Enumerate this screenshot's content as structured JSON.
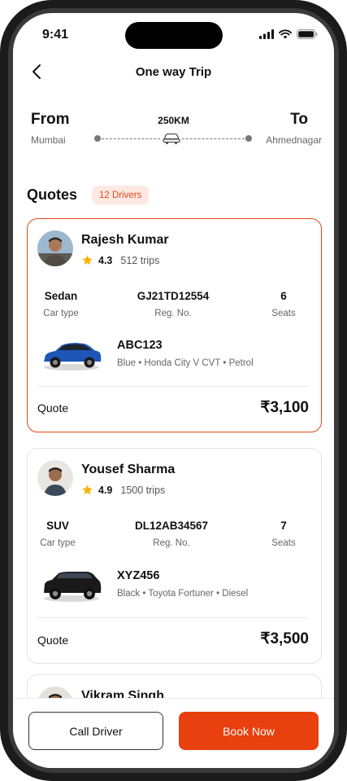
{
  "status_bar": {
    "time": "9:41"
  },
  "header": {
    "title": "One way Trip",
    "back_icon": "chevron-left-icon"
  },
  "route": {
    "from_label": "From",
    "from_city": "Mumbai",
    "to_label": "To",
    "to_city": "Ahmednagar",
    "distance": "250KM"
  },
  "quotes_section": {
    "title": "Quotes",
    "drivers_badge": "12 Drivers"
  },
  "quotes": [
    {
      "driver_name": "Rajesh Kumar",
      "rating": "4.3",
      "trips": "512 trips",
      "car_type": "Sedan",
      "car_type_label": "Car type",
      "reg_no": "GJ21TD12554",
      "reg_no_label": "Reg. No.",
      "seats": "6",
      "seats_label": "Seats",
      "plate": "ABC123",
      "car_desc": "Blue • Honda City V CVT • Petrol",
      "car_color": "#1e56b8",
      "quote_label": "Quote",
      "quote_value": "₹3,100",
      "selected": true
    },
    {
      "driver_name": "Yousef Sharma",
      "rating": "4.9",
      "trips": "1500 trips",
      "car_type": "SUV",
      "car_type_label": "Car type",
      "reg_no": "DL12AB34567",
      "reg_no_label": "Reg. No.",
      "seats": "7",
      "seats_label": "Seats",
      "plate": "XYZ456",
      "car_desc": "Black • Toyota Fortuner • Diesel",
      "car_color": "#1a1a1a",
      "quote_label": "Quote",
      "quote_value": "₹3,500",
      "selected": false
    },
    {
      "driver_name": "Vikram Singh"
    }
  ],
  "actions": {
    "call_driver": "Call Driver",
    "book_now": "Book Now"
  },
  "colors": {
    "accent": "#e8400e",
    "badge_bg": "#fde9e2",
    "star": "#f5b400"
  }
}
